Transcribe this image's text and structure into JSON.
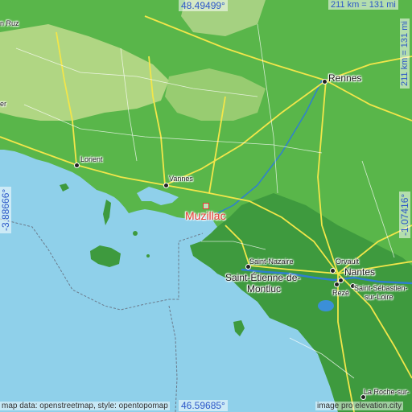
{
  "highlight": {
    "name": "Muzillac",
    "color": "#e53935"
  },
  "coordinates": {
    "north": "48.49499°",
    "south": "46.59685°",
    "west": "-3.88666°",
    "east": "-1.07416°"
  },
  "scale": {
    "horizontal": "211 km = 131 mi",
    "vertical": "211 km = 131 mi"
  },
  "places": {
    "rennes": "Rennes",
    "nantes": "Nantes",
    "saint_etienne_line1": "Saint-Étienne-de-",
    "saint_etienne_line2": "Montluc",
    "lorient": "Lorient",
    "vannes": "Vannes",
    "saint_nazaire": "Saint-Nazaire",
    "orvault": "Orvault",
    "reze": "Rezé",
    "saint_sebastien_line1": "Saint-Sébastien-",
    "saint_sebastien_line2": "sur-Loire",
    "la_roche_line1": "La Roche-sur-",
    "ruz": "n Ruz",
    "sea_partial": "er"
  },
  "attribution": {
    "left": "map data: openstreetmap, style: opentopomap",
    "right": "image pro elevation.city"
  },
  "colors": {
    "sea": "#8fd0ea",
    "lowland": "#3e9a3e",
    "midland": "#6fc255",
    "highland": "#b9d98a",
    "roads": "#f2e64a",
    "rivers": "#2f7fd0"
  }
}
